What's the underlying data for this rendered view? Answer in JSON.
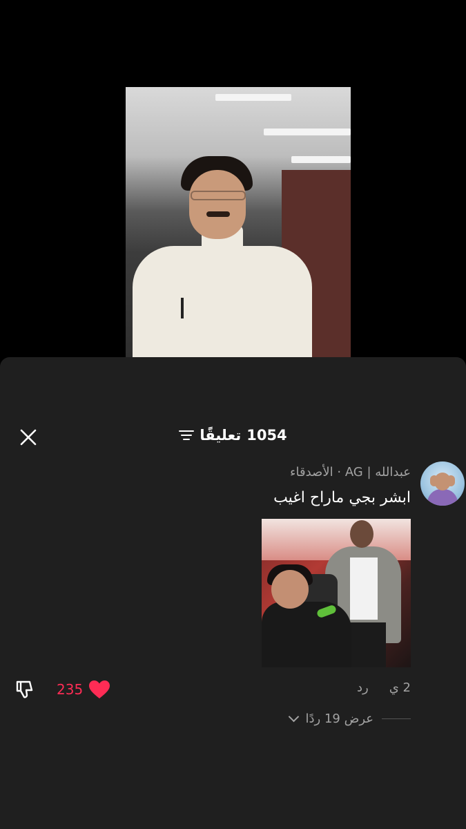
{
  "header": {
    "count": "1054",
    "label": "تعليقًا"
  },
  "icons": {
    "close": "close-icon",
    "filter": "filter-icon",
    "heart": "heart-icon",
    "dislike": "thumbs-down-icon",
    "chevron": "chevron-down-icon"
  },
  "colors": {
    "sheet_bg": "#1f1f1f",
    "like": "#fe2c55",
    "secondary_text": "#a3a3a3"
  },
  "comment": {
    "username": "عبدالله | AG",
    "separator": "·",
    "relation": "الأصدقاء",
    "text": "ابشر بجي ماراح اغيب",
    "time": "2 ي",
    "reply_label": "رد",
    "likes": "235",
    "view_replies": "عرض 19 ردًا"
  }
}
